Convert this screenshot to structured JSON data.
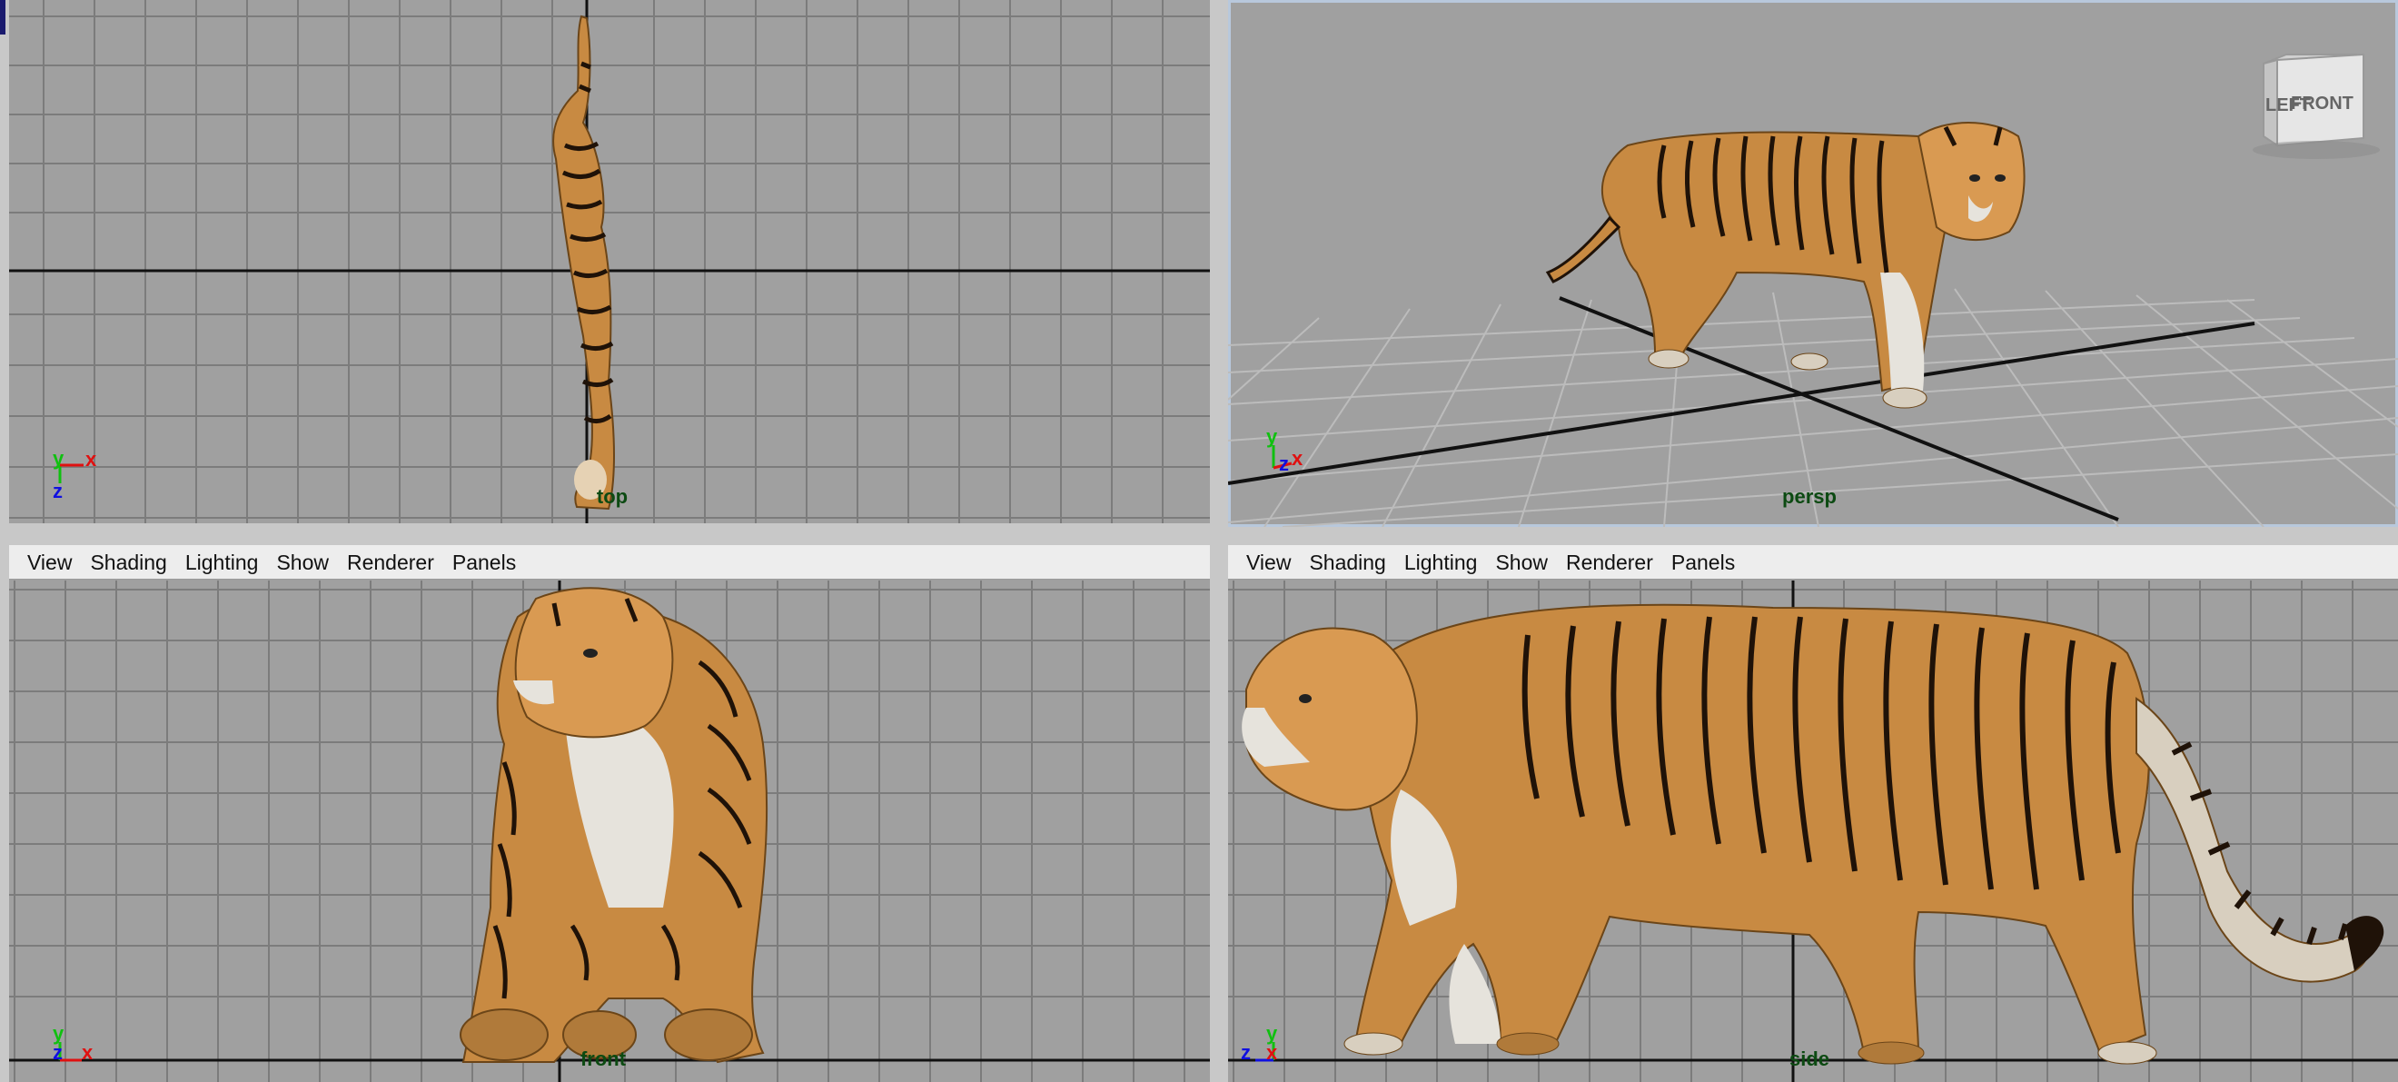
{
  "panels": {
    "top": {
      "camera_label": "top"
    },
    "persp": {
      "camera_label": "persp"
    },
    "front": {
      "camera_label": "front",
      "menu": [
        "View",
        "Shading",
        "Lighting",
        "Show",
        "Renderer",
        "Panels"
      ]
    },
    "side": {
      "camera_label": "side",
      "menu": [
        "View",
        "Shading",
        "Lighting",
        "Show",
        "Renderer",
        "Panels"
      ]
    }
  },
  "view_cube": {
    "left_face": "LEFT",
    "front_face": "FRONT"
  },
  "axis_labels": {
    "x": "x",
    "y": "y",
    "z": "z"
  },
  "colors": {
    "viewport_bg": "#a0a0a0",
    "grid_line": "#7c7c7c",
    "grid_axis": "#111111",
    "axis_x": "#e01010",
    "axis_y": "#10c010",
    "axis_z": "#1010e0",
    "camera_label": "#0c4a12",
    "tiger_body": "#c88a42",
    "tiger_white": "#e6e3dc",
    "tiger_stripe": "#1f1208"
  }
}
